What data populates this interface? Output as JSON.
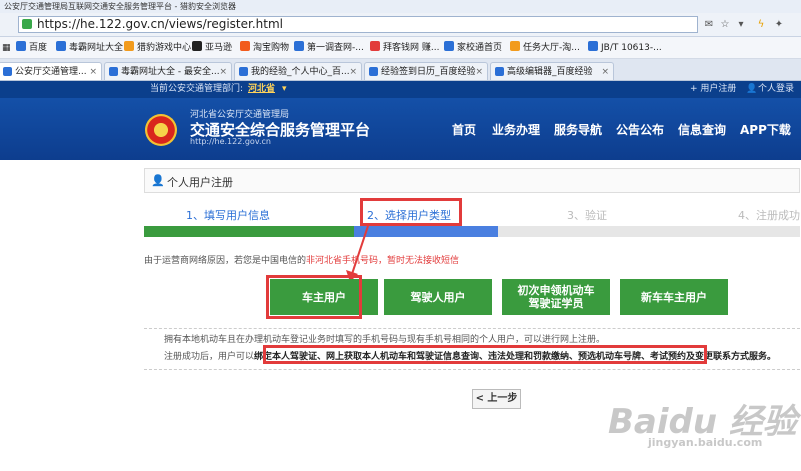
{
  "browser": {
    "title": "公安厅交通管理局互联网交通安全服务管理平台 - 猎豹安全浏览器",
    "url": "https://he.122.gov.cn/views/register.html"
  },
  "bookmarks": [
    {
      "label": "百度",
      "color": "#2b6fd6"
    },
    {
      "label": "毒霸网址大全",
      "color": "#2b6fd6"
    },
    {
      "label": "猎豹游戏中心",
      "color": "#f29b1d"
    },
    {
      "label": "亚马逊",
      "color": "#222222"
    },
    {
      "label": "淘宝购物",
      "color": "#f25b1d"
    },
    {
      "label": "第一调查网-...",
      "color": "#2b6fd6"
    },
    {
      "label": "拜客钱网 赚...",
      "color": "#e23b3b"
    },
    {
      "label": "家校通首页",
      "color": "#2b6fd6"
    },
    {
      "label": "任务大厅-淘...",
      "color": "#f29b1d"
    },
    {
      "label": "JB/T 10613-...",
      "color": "#2b6fd6"
    }
  ],
  "tabs": [
    {
      "label": "公安厅交通管理...",
      "active": true,
      "color": "#2b6fd6"
    },
    {
      "label": "毒霸网址大全 - 最安全...",
      "active": false,
      "color": "#2b6fd6"
    },
    {
      "label": "我的经验_个人中心_百...",
      "active": false,
      "color": "#2b6fd6"
    },
    {
      "label": "经验签到日历_百度经验",
      "active": false,
      "color": "#2b6fd6"
    },
    {
      "label": "高级编辑器_百度经验",
      "active": false,
      "color": "#2b6fd6"
    }
  ],
  "site": {
    "dept_prefix": "当前公安交通管理部门:",
    "dept_name": "河北省",
    "user_register": "+ 用户注册",
    "user_login": "个人登录",
    "logo_small": "河北省公安厅交通管理局",
    "logo_main": "交通安全综合服务管理平台",
    "logo_url": "http://he.122.gov.cn",
    "nav": [
      "首页",
      "业务办理",
      "服务导航",
      "公告公布",
      "信息查询",
      "APP下载"
    ]
  },
  "page": {
    "breadcrumb": "个人用户注册",
    "steps": [
      "1、填写用户信息",
      "2、选择用户类型",
      "3、验证",
      "4、注册成功"
    ],
    "notice_prefix": "由于运营商网络原因，若您是中国电信的",
    "notice_highlight": "非河北省",
    "notice_suffix": "手机号码，暂时无法接收短信",
    "buttons": [
      "车主用户",
      "驾驶人用户",
      "初次申领机动车驾驶证学员",
      "新车车主用户"
    ],
    "info_line1": "拥有本地机动车且在办理机动车登记业务时填写的手机号码与现有手机号相同的个人用户，可以进行网上注册。",
    "info_line2_prefix": "注册成功后，用户可以",
    "info_line2_highlight": "绑定本人驾驶证、网上获取本人机动车和驾驶证信息查询、违法处理和罚款缴纳、预选机动车号牌、考试预约及变更联系方式服务。",
    "prev_button": "< 上一步"
  },
  "watermark": {
    "text": "Baidu 经验",
    "url": "jingyan.baidu.com"
  },
  "colors": {
    "green": "#3a9b3e",
    "blue_bar": "#4a7fe0",
    "annotation_red": "#e23b3b",
    "header_blue": "#1450a8"
  }
}
